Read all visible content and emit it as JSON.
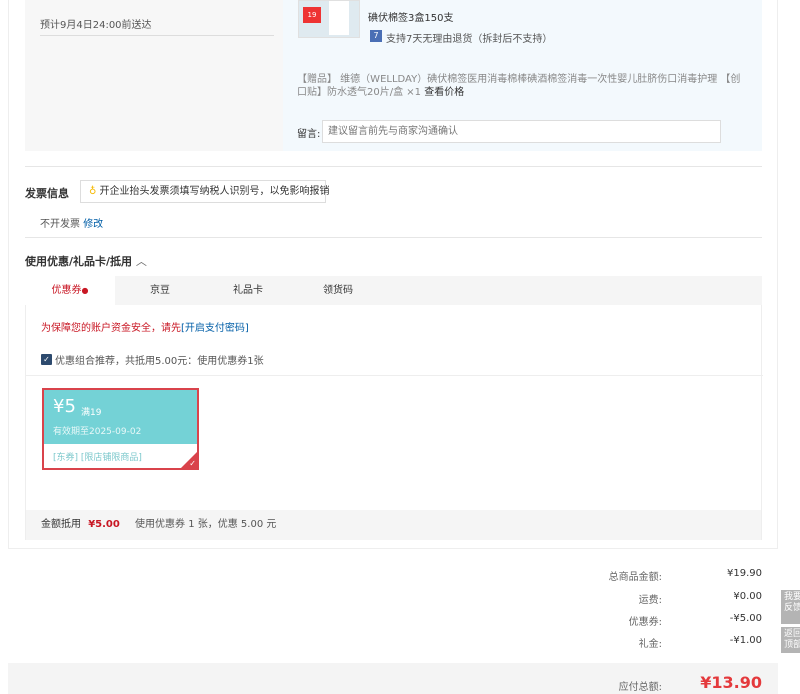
{
  "delivery": {
    "estimate": "预计9月4日24:00前送达"
  },
  "product": {
    "name": "碘伏棉签3盒150支",
    "image_badge": "19",
    "return_policy": "支持7天无理由退货（拆封后不支持）",
    "gift_text": "【赠品】 维德（WELLDAY）碘伏棉签医用消毒棉棒碘酒棉签消毒一次性婴儿肚脐伤口消毒护理 【创口贴】防水透气20片/盒 ×1",
    "gift_price_link": "查看价格",
    "message_label": "留言:",
    "message_placeholder": "建议留言前先与商家沟通确认"
  },
  "invoice": {
    "title": "发票信息",
    "tip": "开企业抬头发票须填写纳税人识别号，以免影响报销",
    "value": "不开发票",
    "edit_link": "修改"
  },
  "discount": {
    "title": "使用优惠/礼品卡/抵用",
    "tabs": [
      {
        "label": "优惠券"
      },
      {
        "label": "京豆"
      },
      {
        "label": "礼品卡"
      },
      {
        "label": "领货码"
      }
    ],
    "warning": "为保障您的账户资金安全，请先",
    "warning_link": "[开启支付密码]",
    "combo_label": "优惠组合推荐，共抵用5.00元：使用优惠券1张",
    "combo_checked": true,
    "coupon": {
      "amount": "¥5",
      "condition": "满19",
      "expiry": "有效期至2025-09-02",
      "tags": "[东券] [限店铺限商品]"
    },
    "footer_label": "金额抵用",
    "footer_amount": "¥5.00",
    "footer_detail": "使用优惠券 1 张，优惠 5.00 元"
  },
  "summary": {
    "rows": [
      {
        "label": "总商品金额:",
        "value": "¥19.90"
      },
      {
        "label": "运费:",
        "value": "¥0.00"
      },
      {
        "label": "优惠券:",
        "value": "-¥5.00"
      },
      {
        "label": "礼金:",
        "value": "-¥1.00"
      }
    ],
    "total_label": "应付总额:",
    "total_value": "¥13.90"
  },
  "side": {
    "feedback": [
      "我要",
      "反馈"
    ],
    "top": [
      "返回",
      "顶部"
    ]
  },
  "colors": {
    "red": "#c81623",
    "teal": "#74d2d6",
    "link": "#005ea7"
  }
}
